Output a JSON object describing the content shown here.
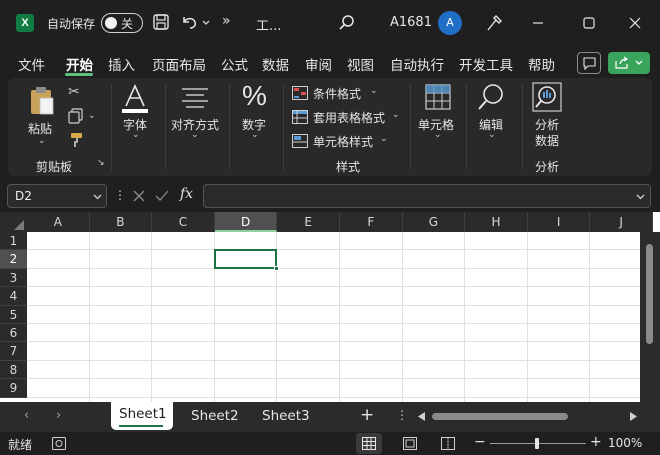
{
  "titlebar": {
    "app_icon": "X",
    "autosave_label": "自动保存",
    "autosave_state": "关",
    "file_name": "工...",
    "user_id": "A1681",
    "avatar_initial": "A",
    "icons": [
      "excel-icon",
      "save-icon",
      "undo-icon",
      "more-icon",
      "search-icon",
      "designer-icon",
      "minimize-icon",
      "maximize-icon",
      "close-icon"
    ]
  },
  "tabs": [
    "文件",
    "开始",
    "插入",
    "页面布局",
    "公式",
    "数据",
    "审阅",
    "视图",
    "自动执行",
    "开发工具",
    "帮助"
  ],
  "active_tab": "开始",
  "ribbon": {
    "paste": "粘贴",
    "clipboard_group": "剪贴板",
    "font": "字体",
    "alignment": "对齐方式",
    "number": "数字",
    "conditional_format": "条件格式",
    "table_format": "套用表格格式",
    "cell_style": "单元格样式",
    "styles_group": "样式",
    "cells": "单元格",
    "editing": "编辑",
    "analyze_line1": "分析",
    "analyze_line2": "数据",
    "analysis_group": "分析"
  },
  "formula_bar": {
    "name_box": "D2",
    "fx": "fx",
    "formula": ""
  },
  "grid": {
    "columns": [
      "A",
      "B",
      "C",
      "D",
      "E",
      "F",
      "G",
      "H",
      "I",
      "J"
    ],
    "rows": [
      "1",
      "2",
      "3",
      "4",
      "5",
      "6",
      "7",
      "8",
      "9"
    ],
    "selected_column": "D",
    "selected_row": "2",
    "active_cell": "D2"
  },
  "sheets": {
    "tabs": [
      "Sheet1",
      "Sheet2",
      "Sheet3"
    ],
    "active": "Sheet1",
    "add_label": "+"
  },
  "status": {
    "mode": "就绪",
    "zoom": "100%"
  },
  "colors": {
    "accent_green": "#1e7145",
    "share_green": "#3aa45c",
    "avatar_blue": "#1f6fc6"
  }
}
